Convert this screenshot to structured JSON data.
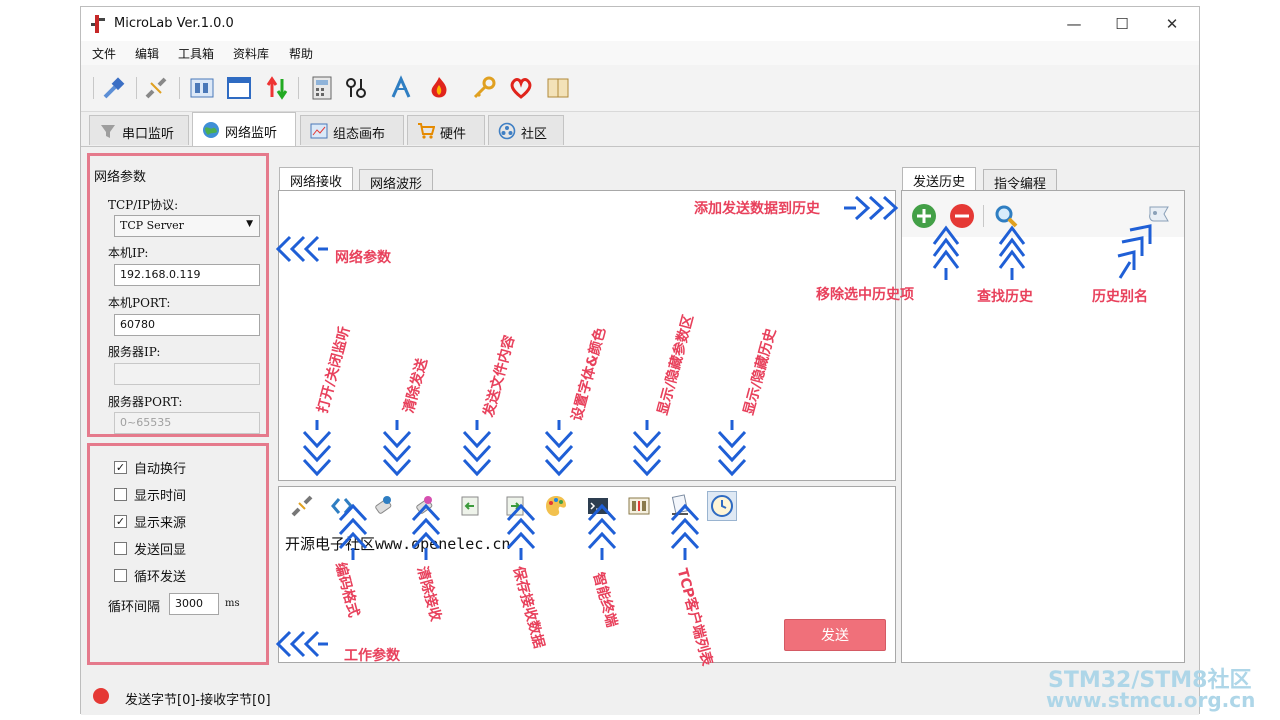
{
  "window": {
    "title": "MicroLab Ver.1.0.0",
    "minimize": "—",
    "maximize": "☐",
    "close": "✕"
  },
  "menu": [
    "文件",
    "编辑",
    "工具箱",
    "资料库",
    "帮助"
  ],
  "main_tabs": [
    {
      "label": "串口监听",
      "icon": "funnel-icon",
      "active": false
    },
    {
      "label": "网络监听",
      "icon": "globe-icon",
      "active": true
    },
    {
      "label": "组态画布",
      "icon": "canvas-icon",
      "active": false
    },
    {
      "label": "硬件",
      "icon": "cart-icon",
      "active": false
    },
    {
      "label": "社区",
      "icon": "community-icon",
      "active": false
    }
  ],
  "net_params": {
    "header": "网络参数",
    "protocol_label": "TCP/IP协议:",
    "protocol_value": "TCP Server",
    "local_ip_label": "本机IP:",
    "local_ip_value": "192.168.0.119",
    "local_port_label": "本机PORT:",
    "local_port_value": "60780",
    "server_ip_label": "服务器IP:",
    "server_ip_value": "",
    "server_port_label": "服务器PORT:",
    "server_port_placeholder": "0~65535"
  },
  "work_params": {
    "options": [
      {
        "label": "自动换行",
        "checked": true
      },
      {
        "label": "显示时间",
        "checked": false
      },
      {
        "label": "显示来源",
        "checked": true
      },
      {
        "label": "发送回显",
        "checked": false
      },
      {
        "label": "循环发送",
        "checked": false
      }
    ],
    "interval_label": "循环间隔",
    "interval_value": "3000",
    "interval_unit": "ms"
  },
  "receive_tabs": [
    "网络接收",
    "网络波形"
  ],
  "send_text": "开源电子社区www.openelec.cn",
  "send_button": "发送",
  "history_tabs": [
    "发送历史",
    "指令编程"
  ],
  "status": {
    "text": "发送字节[0]-接收字节[0]",
    "led_color": "#e53935"
  },
  "annotations": {
    "net_params": "网络参数",
    "work_params": "工作参数",
    "add_history": "添加发送数据到历史",
    "remove_history": "移除选中历史项",
    "find_history": "查找历史",
    "alias_history": "历史别名",
    "open_close": "打开/关闭监听",
    "clear_send": "清除发送",
    "send_file": "发送文件内容",
    "font_color": "设置字体&颜色",
    "toggle_params": "显示/隐藏参数区",
    "toggle_history": "显示/隐藏历史",
    "encoding": "编码格式",
    "clear_receive": "清除接收",
    "save_receive": "保存接收数据",
    "smart_terminal": "智能终端",
    "tcp_clients": "TCP客户端列表"
  },
  "watermark": {
    "line1": "STM32/STM8社区",
    "line2": "www.stmcu.org.cn"
  },
  "colors": {
    "annotation": "#e8415c",
    "arrow": "#1f5fd6",
    "highlight_box": "#e57a8c",
    "send_button": "#f0707a"
  }
}
